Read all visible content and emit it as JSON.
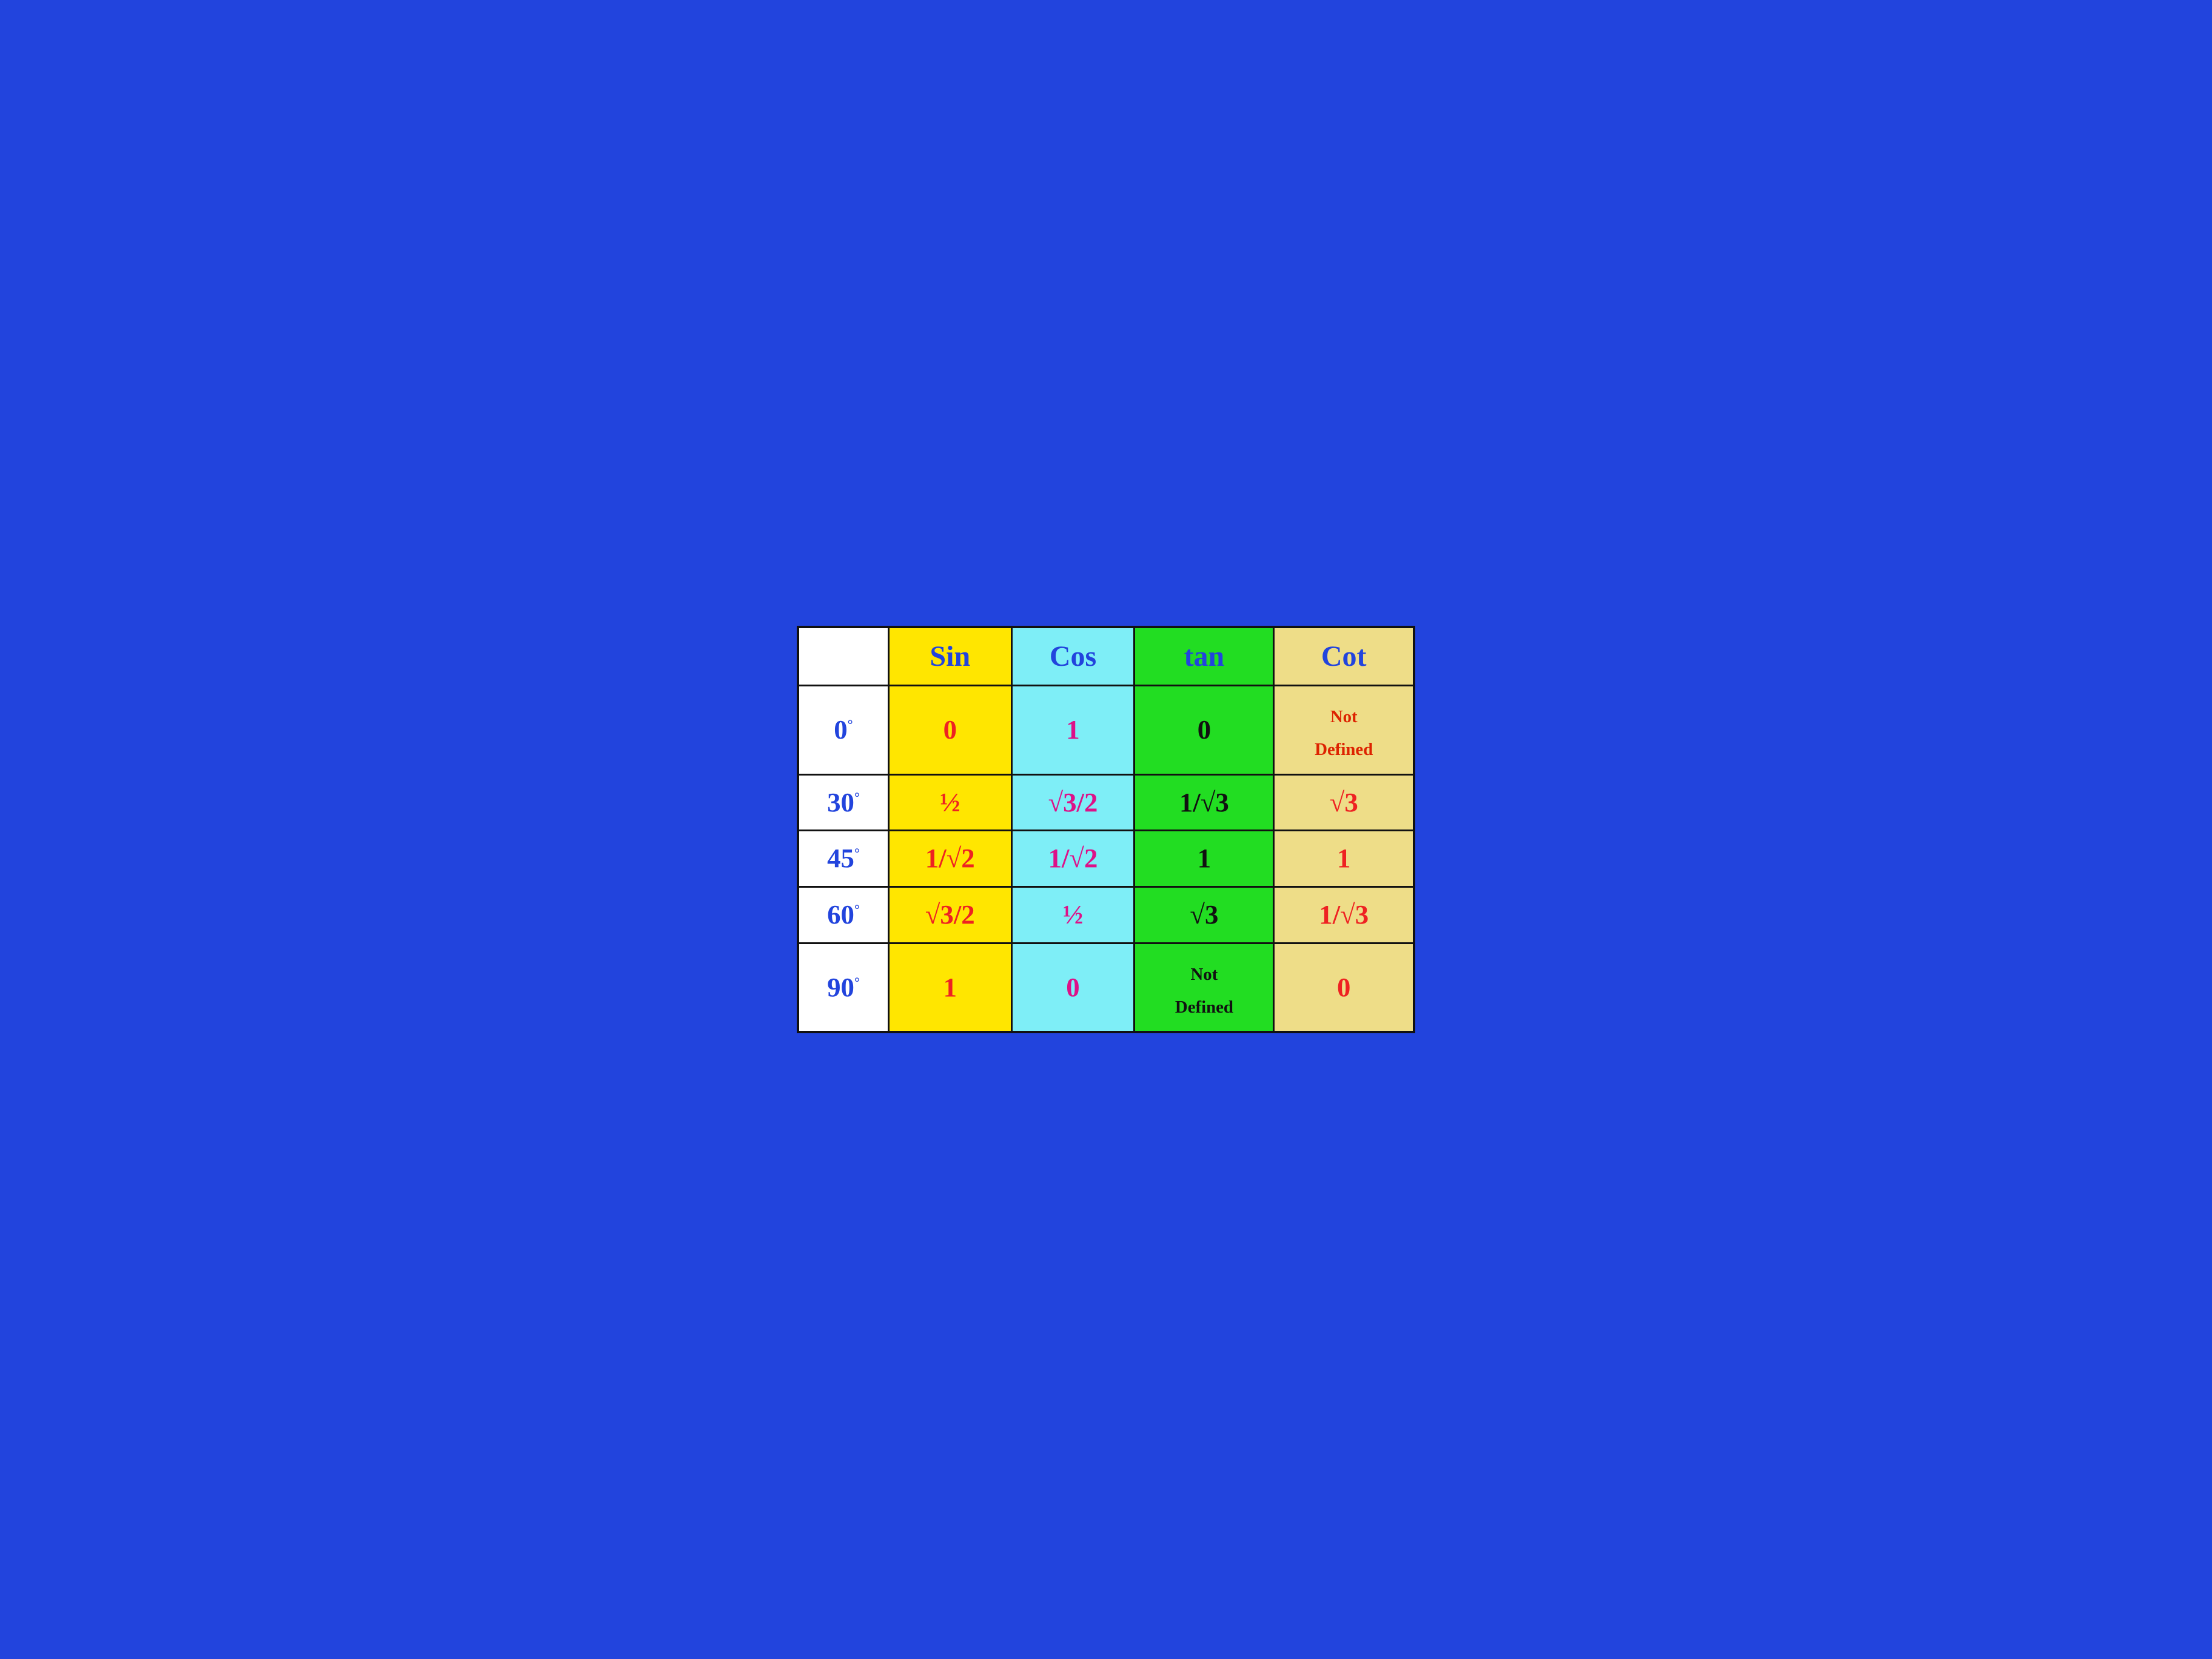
{
  "table": {
    "headers": {
      "angle": "",
      "sin": "Sin",
      "cos": "Cos",
      "tan": "tan",
      "cot": "Cot"
    },
    "rows": [
      {
        "angle": "0°",
        "sin": "0",
        "cos": "1",
        "tan": "0",
        "cot": "Not Defined"
      },
      {
        "angle": "30°",
        "sin": "½",
        "cos": "√3/2",
        "tan": "1/√3",
        "cot": "√3"
      },
      {
        "angle": "45°",
        "sin": "1/√2",
        "cos": "1/√2",
        "tan": "1",
        "cot": "1"
      },
      {
        "angle": "60°",
        "sin": "√3/2",
        "cos": "½",
        "tan": "√3",
        "cot": "1/√3"
      },
      {
        "angle": "90°",
        "sin": "1",
        "cos": "0",
        "tan": "Not Defined",
        "cot": "0"
      }
    ]
  }
}
